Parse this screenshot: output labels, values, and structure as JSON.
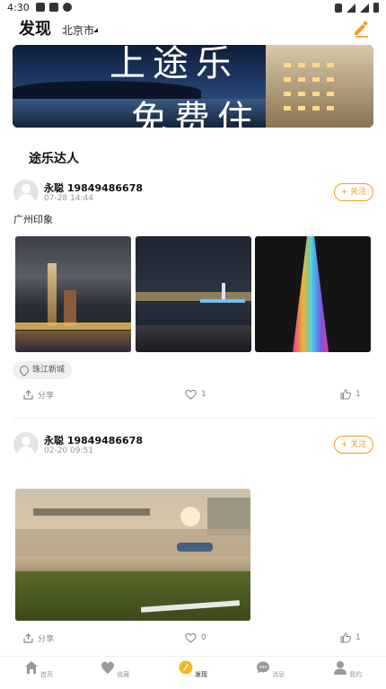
{
  "status_bar": {
    "time": "4:30"
  },
  "header": {
    "title": "发现",
    "city": "北京市"
  },
  "banner": {
    "text_line1": "上途乐",
    "text_line2": "免费住"
  },
  "section": {
    "title": "途乐达人"
  },
  "posts": [
    {
      "user": "永聪 19849486678",
      "date": "07-28 14:44",
      "follow": "+ 关注",
      "text": "广州印象",
      "location": "珠江新城",
      "share": "分享",
      "comments": "1",
      "likes": "1"
    },
    {
      "user": "永聪 19849486678",
      "date": "02-20 09:51",
      "follow": "+ 关注",
      "text": "",
      "share": "分享",
      "comments": "0",
      "likes": "1"
    }
  ],
  "tabs": [
    {
      "label": "首页",
      "icon": "home-icon"
    },
    {
      "label": "收藏",
      "icon": "heart-icon"
    },
    {
      "label": "发现",
      "icon": "discover-icon"
    },
    {
      "label": "消息",
      "icon": "message-icon"
    },
    {
      "label": "我的",
      "icon": "user-icon"
    }
  ],
  "colors": {
    "accent": "#f0a020",
    "active_tab": "#f5b81e"
  }
}
